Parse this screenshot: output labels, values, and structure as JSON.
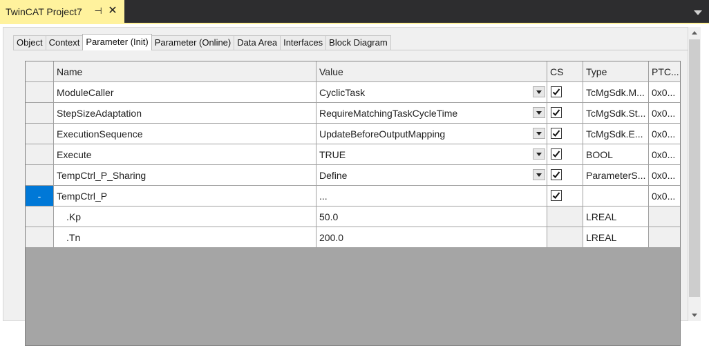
{
  "document_tab": {
    "title": "TwinCAT Project7",
    "pin_glyph": "⊣",
    "close_glyph": "✕"
  },
  "editor_tabs": [
    "Object",
    "Context",
    "Parameter (Init)",
    "Parameter (Online)",
    "Data Area",
    "Interfaces",
    "Block Diagram"
  ],
  "active_tab": "Parameter (Init)",
  "grid": {
    "columns": [
      "Name",
      "Value",
      "CS",
      "Type",
      "PTC..."
    ],
    "rows": [
      {
        "selector": "",
        "name": "ModuleCaller",
        "value": "CyclicTask",
        "dropdown": true,
        "cs": true,
        "type": "TcMgSdk.M...",
        "ptc": "0x0..."
      },
      {
        "selector": "",
        "name": "StepSizeAdaptation",
        "value": "RequireMatchingTaskCycleTime",
        "dropdown": true,
        "cs": true,
        "type": "TcMgSdk.St...",
        "ptc": "0x0..."
      },
      {
        "selector": "",
        "name": "ExecutionSequence",
        "value": "UpdateBeforeOutputMapping",
        "dropdown": true,
        "cs": true,
        "type": "TcMgSdk.E...",
        "ptc": "0x0..."
      },
      {
        "selector": "",
        "name": "Execute",
        "value": "TRUE",
        "dropdown": true,
        "cs": true,
        "type": "BOOL",
        "ptc": "0x0..."
      },
      {
        "selector": "",
        "name": "TempCtrl_P_Sharing",
        "value": "Define",
        "dropdown": true,
        "cs": true,
        "type": "ParameterS...",
        "ptc": "0x0..."
      },
      {
        "selector": "-",
        "name": "TempCtrl_P",
        "value": "...",
        "dropdown": false,
        "cs": true,
        "type": "",
        "ptc": "0x0..."
      },
      {
        "selector": "",
        "name": ".Kp",
        "value": "50.0",
        "dropdown": false,
        "cs": null,
        "type": "LREAL",
        "ptc": ""
      },
      {
        "selector": "",
        "name": ".Tn",
        "value": "200.0",
        "dropdown": false,
        "cs": null,
        "type": "LREAL",
        "ptc": ""
      }
    ]
  },
  "colors": {
    "doc_tab_active": "#fff29d",
    "selection": "#0078d7",
    "grid_empty_area": "#a5a5a5"
  }
}
